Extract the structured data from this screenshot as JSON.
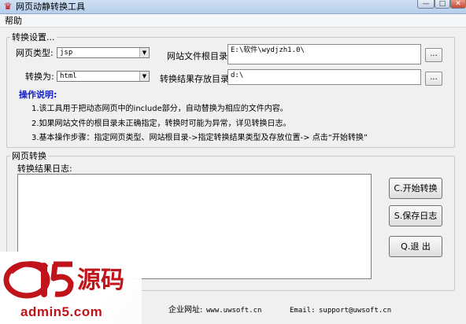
{
  "window": {
    "title": "网页动静转换工具",
    "min_glyph": "—",
    "max_glyph": "□",
    "close_glyph": "✕"
  },
  "menu": {
    "items": [
      {
        "label": "帮助"
      }
    ]
  },
  "settings": {
    "legend": "转换设置...",
    "page_type_label": "网页类型:",
    "page_type_value": "jsp",
    "root_label": "网站文件根目录:",
    "root_value": "E:\\软件\\wydjzh1.0\\",
    "convert_to_label": "转换为:",
    "convert_to_value": "html",
    "output_label": "转换结果存放目录:",
    "output_value": "d:\\",
    "browse_label": "...",
    "help_heading": "操作说明:",
    "help_lines": [
      "1.该工具用于把动态网页中的include部分，自动替换为相应的文件内容。",
      "2.如果网站文件的根目录未正确指定，转换时可能为异常，详见转换日志。",
      "3.基本操作步骤：指定网页类型、网站根目录->指定转换结果类型及存放位置-> 点击“开始转换”"
    ]
  },
  "convert": {
    "legend": "网页转换",
    "log_label": "转换结果日志:",
    "log_text": "",
    "start_button": "C.开始转换",
    "save_log_button": "S.保存日志",
    "exit_button": "Q.退  出"
  },
  "footer": {
    "site_label": "企业网址:",
    "site_value": "www.uwsoft.cn",
    "email_label": "Email:",
    "email_value": "support@uwsoft.cn"
  },
  "watermark": {
    "logo_text": "a5源码",
    "sub_text": "admin5.com"
  },
  "colors": {
    "help_heading": "#1520c8",
    "watermark_red": "#c0141a"
  }
}
